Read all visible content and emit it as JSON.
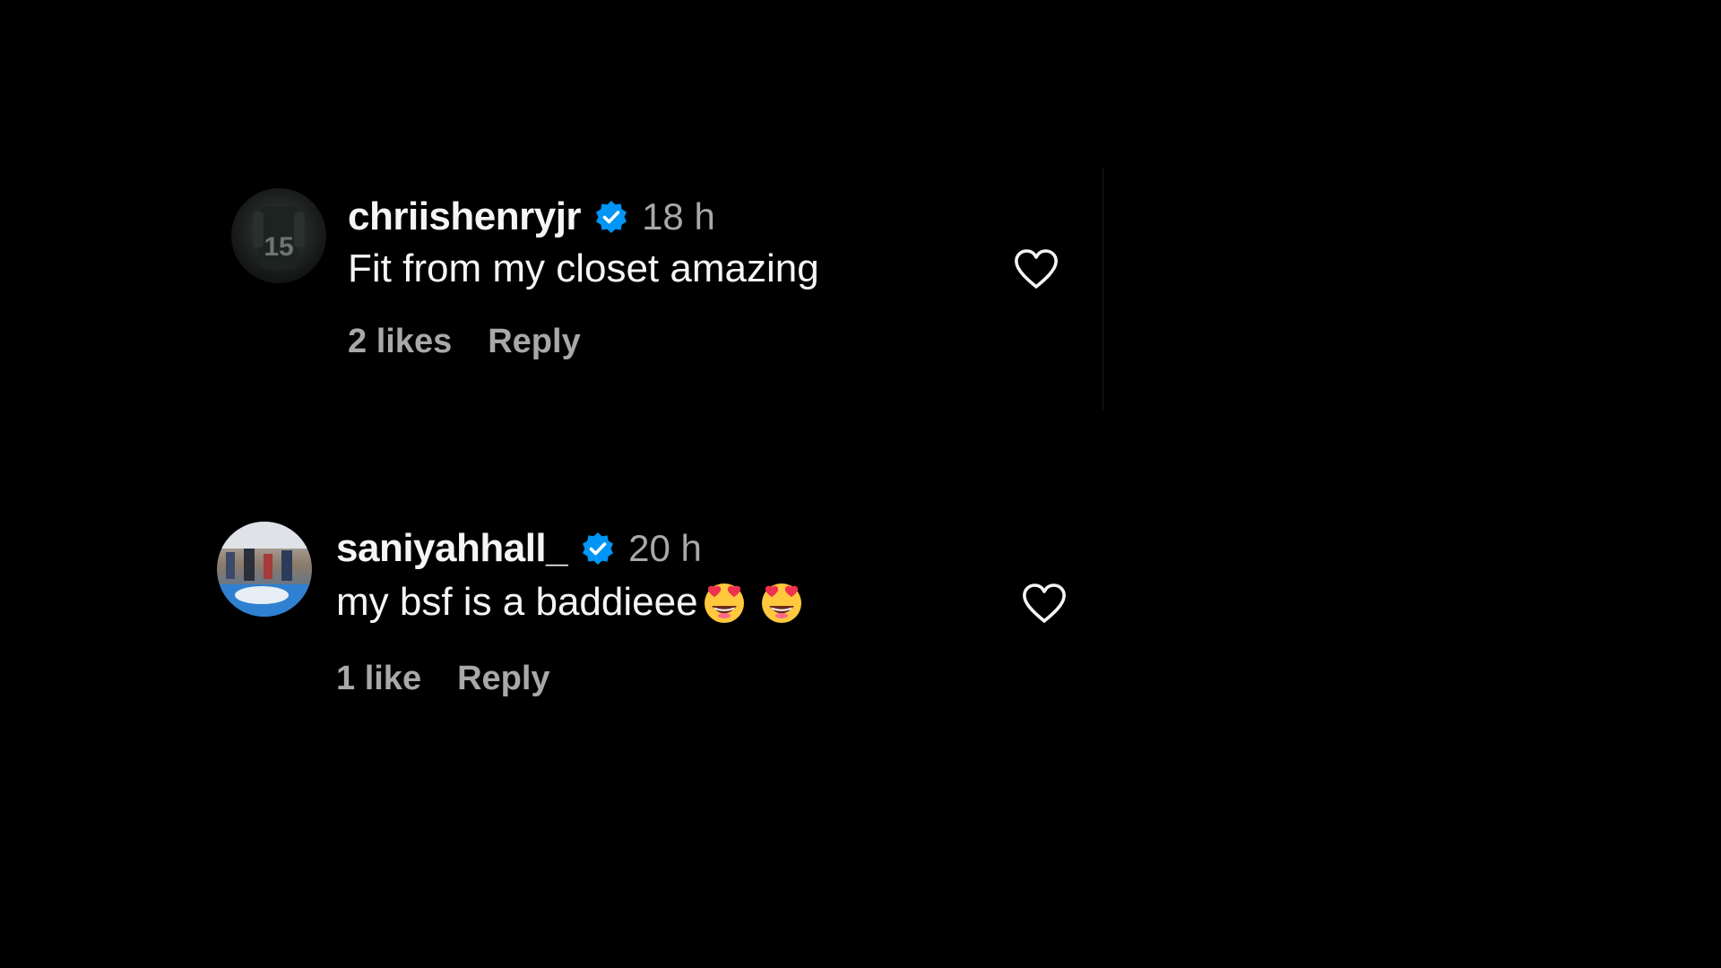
{
  "comments": [
    {
      "username": "chriishenryjr",
      "time": "18 h",
      "text": "Fit from my closet amazing",
      "emoji": [],
      "likes": "2 likes",
      "reply": "Reply",
      "avatar_jersey": "15"
    },
    {
      "username": "saniyahhall_",
      "time": "20 h",
      "text": "my bsf is a baddieee",
      "emoji": [
        "smiling-face-with-heart-eyes",
        "smiling-face-with-heart-eyes"
      ],
      "likes": "1 like",
      "reply": "Reply"
    }
  ],
  "colors": {
    "background": "#000000",
    "primary_text": "#f5f5f5",
    "secondary_text": "#a8a8a8",
    "verified_blue": "#0095f6"
  },
  "icons": {
    "verified": "verified-badge-icon",
    "like": "heart-outline-icon",
    "emoji": "smiling-face-with-heart-eyes-emoji"
  }
}
